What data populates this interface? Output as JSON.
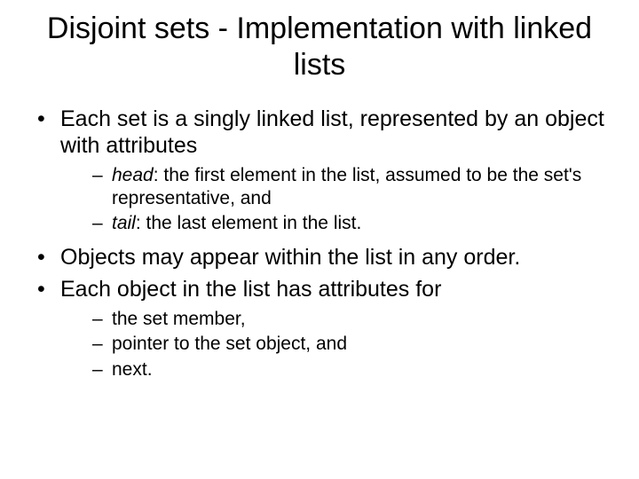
{
  "title": "Disjoint sets - Implementation with linked lists",
  "bullets": [
    {
      "text": "Each set is a singly linked list, represented by an object with attributes",
      "sub": [
        {
          "em": "head",
          "rest": ": the first element in the list, assumed to be the set's representative, and"
        },
        {
          "em": "tail",
          "rest": ": the last element in the list."
        }
      ]
    },
    {
      "text": "Objects may appear within the list in any order."
    },
    {
      "text": "Each object in the list has attributes for",
      "sub": [
        {
          "rest": "the set member,"
        },
        {
          "rest": "pointer to the set object, and"
        },
        {
          "rest": "next."
        }
      ]
    }
  ]
}
